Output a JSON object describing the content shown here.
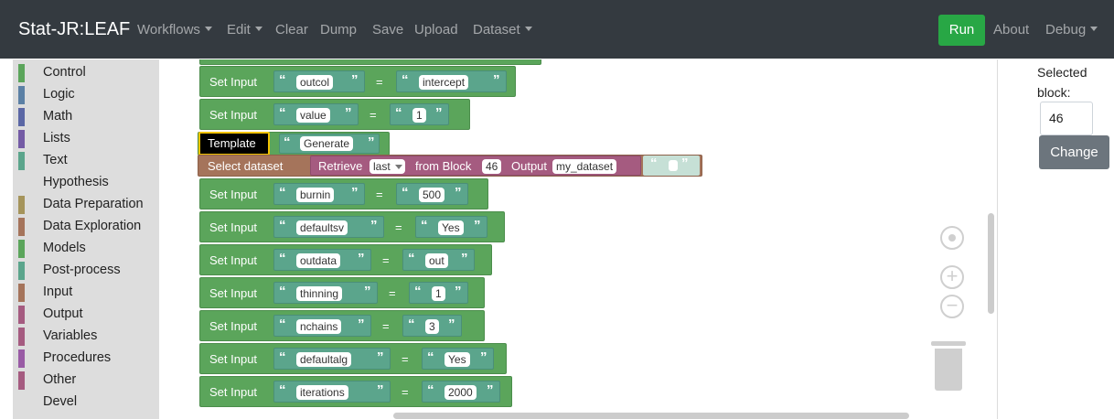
{
  "navbar": {
    "brand": "Stat-JR:LEAF",
    "items": [
      "Workflows",
      "Edit",
      "Clear",
      "Dump",
      "Save",
      "Upload",
      "Dataset"
    ],
    "run_label": "Run",
    "about_label": "About",
    "debug_label": "Debug"
  },
  "toolbox": {
    "categories": [
      {
        "label": "Control",
        "color": "#5ba55b"
      },
      {
        "label": "Logic",
        "color": "#5b80a5"
      },
      {
        "label": "Math",
        "color": "#5b67a5"
      },
      {
        "label": "Lists",
        "color": "#745ba5"
      },
      {
        "label": "Text",
        "color": "#5ba58c"
      },
      {
        "label": "Hypothesis",
        "color": ""
      },
      {
        "label": "Data Preparation",
        "color": "#a5945b"
      },
      {
        "label": "Data Exploration",
        "color": "#a5745b"
      },
      {
        "label": "Models",
        "color": "#5ba55b"
      },
      {
        "label": "Post-process",
        "color": "#5ba58c"
      },
      {
        "label": "Input",
        "color": "#a5745b"
      },
      {
        "label": "Output",
        "color": "#a55b80"
      },
      {
        "label": "Variables",
        "color": "#a55b80"
      },
      {
        "label": "Procedures",
        "color": "#995ba5"
      },
      {
        "label": "Other",
        "color": "#a55b80"
      },
      {
        "label": "Devel",
        "color": ""
      }
    ]
  },
  "workspace": {
    "set_input_label": "Set Input",
    "template_label": "Template",
    "template_value": "Generate",
    "select_dataset_label": "Select dataset",
    "retrieve_label": "Retrieve",
    "retrieve_option": "last",
    "from_block_label": "from Block",
    "from_block_value": "46",
    "output_label": "Output",
    "output_value": "my_dataset",
    "set_inputs": [
      {
        "key": "outcol",
        "value": "intercept"
      },
      {
        "key": "value",
        "value": "1"
      },
      {
        "key": "burnin",
        "value": "500"
      },
      {
        "key": "defaultsv",
        "value": "Yes"
      },
      {
        "key": "outdata",
        "value": "out"
      },
      {
        "key": "thinning",
        "value": "1"
      },
      {
        "key": "nchains",
        "value": "3"
      },
      {
        "key": "defaultalg",
        "value": "Yes"
      },
      {
        "key": "iterations",
        "value": "2000"
      }
    ]
  },
  "panel": {
    "selected_block_label": "Selected block:",
    "selected_block_value": "46",
    "change_label": "Change"
  }
}
